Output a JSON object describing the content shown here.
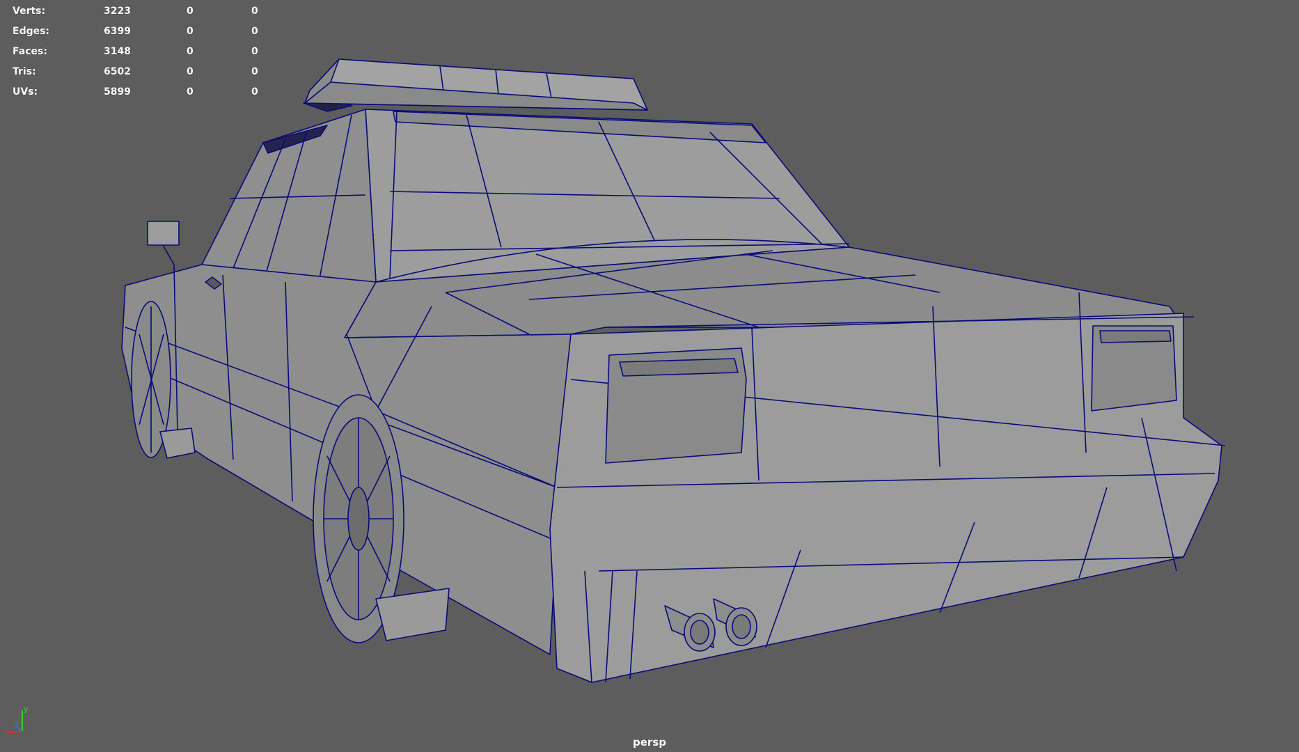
{
  "stats": [
    {
      "label": "Verts:",
      "v1": "3223",
      "v2": "0",
      "v3": "0"
    },
    {
      "label": "Edges:",
      "v1": "6399",
      "v2": "0",
      "v3": "0"
    },
    {
      "label": "Faces:",
      "v1": "3148",
      "v2": "0",
      "v3": "0"
    },
    {
      "label": "Tris:",
      "v1": "6502",
      "v2": "0",
      "v3": "0"
    },
    {
      "label": "UVs:",
      "v1": "5899",
      "v2": "0",
      "v3": "0"
    }
  ],
  "camera_label": "persp",
  "axis": {
    "y": "y",
    "z": "z",
    "x": "x"
  },
  "colors": {
    "viewport_bg": "#5d5d5d",
    "mesh_fill": "#9a9a9a",
    "mesh_fill_dark": "#7e7e7e",
    "wire": "#0a0a78",
    "axis_y": "#35d135",
    "axis_x": "#e03030",
    "axis_z": "#3a6bff"
  }
}
